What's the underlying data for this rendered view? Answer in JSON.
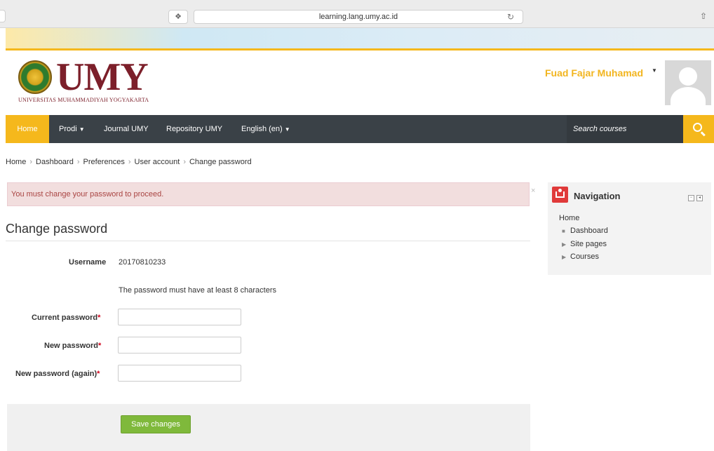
{
  "browser": {
    "url": "learning.lang.umy.ac.id",
    "reader_glyph": "❖",
    "reload_glyph": "↻",
    "share_glyph": "⇧"
  },
  "header": {
    "logo_text": "UMY",
    "logo_subtitle": "UNIVERSITAS MUHAMMADIYAH YOGYAKARTA",
    "user_name": "Fuad Fajar Muhamad",
    "user_caret": "▼"
  },
  "navbar": {
    "home": "Home",
    "prodi": "Prodi",
    "journal": "Journal UMY",
    "repository": "Repository UMY",
    "language": "English (en)",
    "caret": "▼",
    "search_placeholder": "Search courses"
  },
  "breadcrumb": {
    "items": [
      "Home",
      "Dashboard",
      "Preferences",
      "User account",
      "Change password"
    ],
    "separator": "›"
  },
  "alert": {
    "message": "You must change your password to proceed.",
    "close": "×"
  },
  "form": {
    "title": "Change password",
    "username_label": "Username",
    "username_value": "20170810233",
    "policy_note": "The password must have at least 8 characters",
    "current_password_label": "Current password",
    "new_password_label": "New password",
    "new_password_again_label": "New password (again)",
    "required_marker": "*",
    "save_button": "Save changes"
  },
  "navigation_block": {
    "title": "Navigation",
    "items": [
      "Home",
      "Dashboard",
      "Site pages",
      "Courses"
    ],
    "bullet_dot": "■",
    "bullet_arrow": "▶",
    "ctrl_min": "−",
    "ctrl_dock": "◂"
  },
  "colors": {
    "accent": "#f5b81c",
    "navbar": "#3a4147",
    "alert_bg": "#f2dede",
    "alert_text": "#a94442",
    "save_button": "#7fb93b",
    "logo": "#7c1f2a"
  }
}
